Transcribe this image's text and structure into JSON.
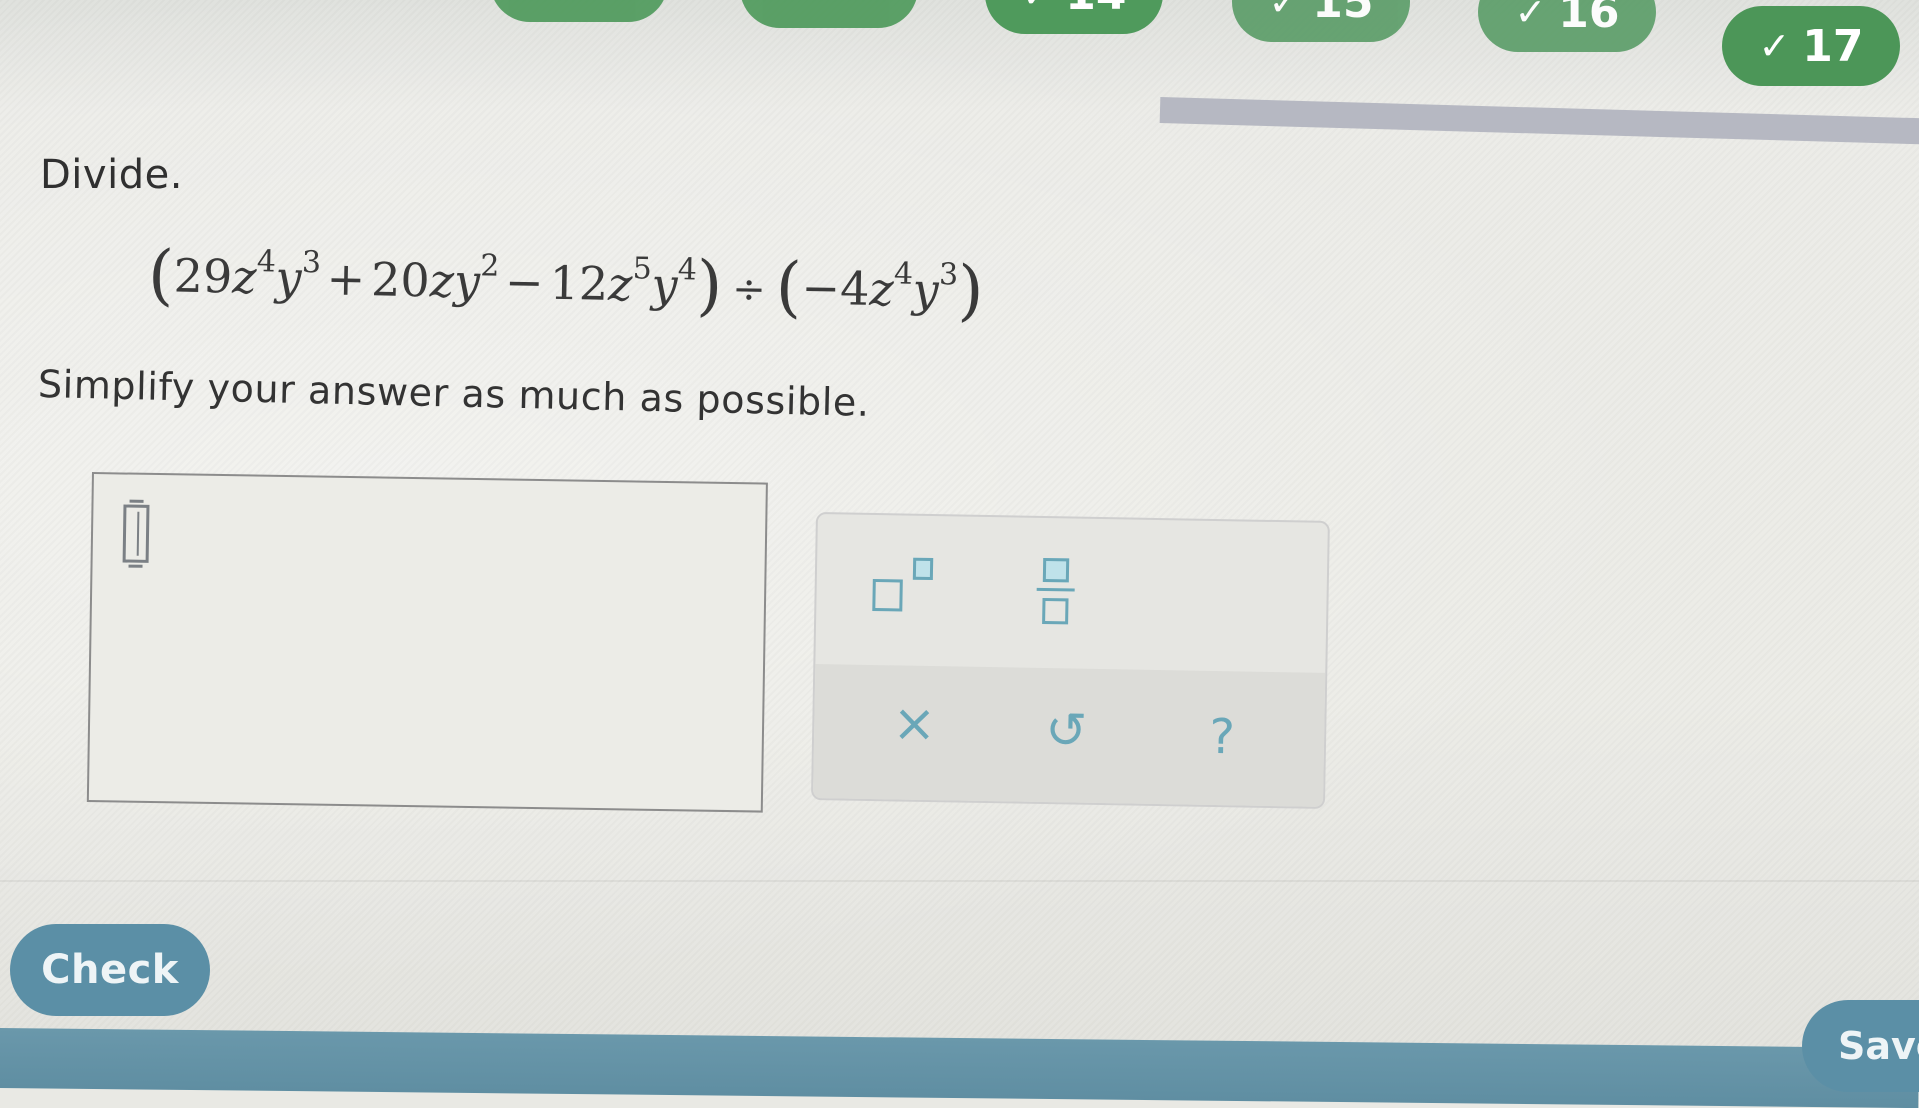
{
  "nav": {
    "questions": [
      {
        "label": "",
        "completed": true
      },
      {
        "label": "",
        "completed": true
      },
      {
        "label": "14",
        "completed": true
      },
      {
        "label": "15",
        "completed": true
      },
      {
        "label": "16",
        "completed": true
      },
      {
        "label": "17",
        "completed": true
      }
    ],
    "check_icon": "✓",
    "accent_color": "#4f9a5c"
  },
  "question": {
    "prompt": "Divide.",
    "expression": {
      "dividend": [
        {
          "coef": "29",
          "z_exp": "4",
          "y_exp": "3",
          "sign": ""
        },
        {
          "coef": "20",
          "z_exp": "",
          "y_exp": "2",
          "sign": "+"
        },
        {
          "coef": "12",
          "z_exp": "5",
          "y_exp": "4",
          "sign": "−"
        }
      ],
      "divisor": {
        "coef": "−4",
        "z_exp": "4",
        "y_exp": "3"
      },
      "operator": "÷"
    },
    "instruction": "Simplify your answer as much as possible."
  },
  "answer": {
    "value": "",
    "placeholder": ""
  },
  "toolbar": {
    "tools": [
      "exponent-icon",
      "fraction-icon",
      "clear-icon",
      "undo-icon",
      "help-icon"
    ],
    "clear_symbol": "×",
    "undo_symbol": "↺",
    "help_symbol": "?",
    "icon_color": "#6aa7b8"
  },
  "actions": {
    "check_label": "Check",
    "save_label": "Save",
    "button_color": "#5b8fa6"
  }
}
